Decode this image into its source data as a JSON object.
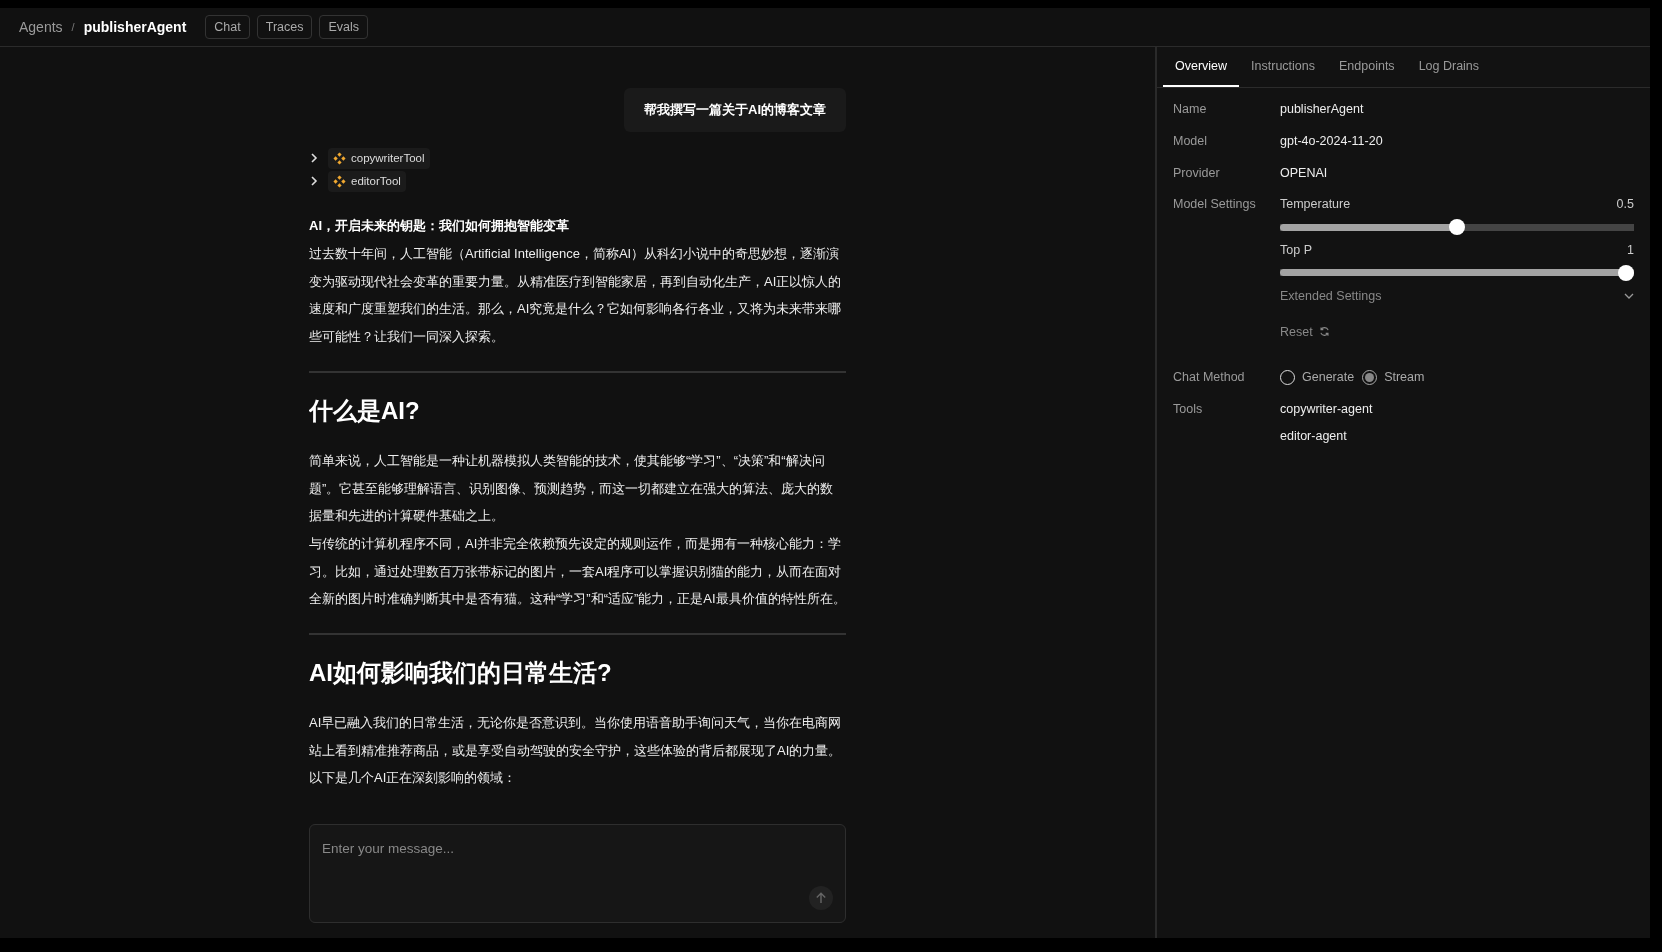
{
  "breadcrumb": {
    "parent": "Agents",
    "separator": "/",
    "current": "publisherAgent"
  },
  "nav_buttons": [
    "Chat",
    "Traces",
    "Evals"
  ],
  "chat": {
    "user_message": "帮我撰写一篇关于AI的博客文章",
    "tool_calls": [
      {
        "name": "copywriterTool",
        "expanded": false
      },
      {
        "name": "editorTool",
        "expanded": false
      }
    ],
    "response": [
      {
        "kind": "title",
        "text": "AI，开启未来的钥匙：我们如何拥抱智能变革"
      },
      {
        "kind": "paragraph",
        "text": "过去数十年间，人工智能（Artificial Intelligence，简称AI）从科幻小说中的奇思妙想，逐渐演变为驱动现代社会变革的重要力量。从精准医疗到智能家居，再到自动化生产，AI正以惊人的速度和广度重塑我们的生活。那么，AI究竟是什么？它如何影响各行各业，又将为未来带来哪些可能性？让我们一同深入探索。"
      },
      {
        "kind": "divider"
      },
      {
        "kind": "heading",
        "text": "什么是AI?"
      },
      {
        "kind": "paragraph",
        "text": "简单来说，人工智能是一种让机器模拟人类智能的技术，使其能够“学习”、“决策”和“解决问题”。它甚至能够理解语言、识别图像、预测趋势，而这一切都建立在强大的算法、庞大的数据量和先进的计算硬件基础之上。"
      },
      {
        "kind": "paragraph",
        "text": "与传统的计算机程序不同，AI并非完全依赖预先设定的规则运作，而是拥有一种核心能力：学习。比如，通过处理数百万张带标记的图片，一套AI程序可以掌握识别猫的能力，从而在面对全新的图片时准确判断其中是否有猫。这种“学习”和“适应”能力，正是AI最具价值的特性所在。"
      },
      {
        "kind": "divider"
      },
      {
        "kind": "heading",
        "text": "AI如何影响我们的日常生活?"
      },
      {
        "kind": "paragraph",
        "text": "AI早已融入我们的日常生活，无论你是否意识到。当你使用语音助手询问天气，当你在电商网站上看到精准推荐商品，或是享受自动驾驶的安全守护，这些体验的背后都展现了AI的力量。"
      },
      {
        "kind": "paragraph",
        "text": "以下是几个AI正在深刻影响的领域："
      }
    ],
    "composer": {
      "placeholder": "Enter your message..."
    }
  },
  "panel": {
    "tabs": [
      {
        "label": "Overview",
        "selected": true
      },
      {
        "label": "Instructions",
        "selected": false
      },
      {
        "label": "Endpoints",
        "selected": false
      },
      {
        "label": "Log Drains",
        "selected": false
      }
    ],
    "fields": [
      {
        "kind": "text",
        "label": "Name",
        "value": "publisherAgent"
      },
      {
        "kind": "text",
        "label": "Model",
        "value": "gpt-4o-2024-11-20"
      },
      {
        "kind": "text",
        "label": "Provider",
        "value": "OPENAI"
      },
      {
        "kind": "settings",
        "label": "Model Settings",
        "sliders": [
          {
            "name": "Temperature",
            "reading": "0.5",
            "level": 0.5
          },
          {
            "name": "Top P",
            "reading": "1",
            "level": 1
          }
        ],
        "extended": {
          "label": "Extended Settings",
          "expanded": false
        },
        "reset": "Reset"
      },
      {
        "kind": "radio",
        "label": "Chat Method",
        "options": [
          {
            "label": "Generate",
            "selected": false
          },
          {
            "label": "Stream",
            "selected": true
          }
        ]
      },
      {
        "kind": "list",
        "label": "Tools",
        "items": [
          "copywriter-agent",
          "editor-agent"
        ]
      }
    ]
  }
}
